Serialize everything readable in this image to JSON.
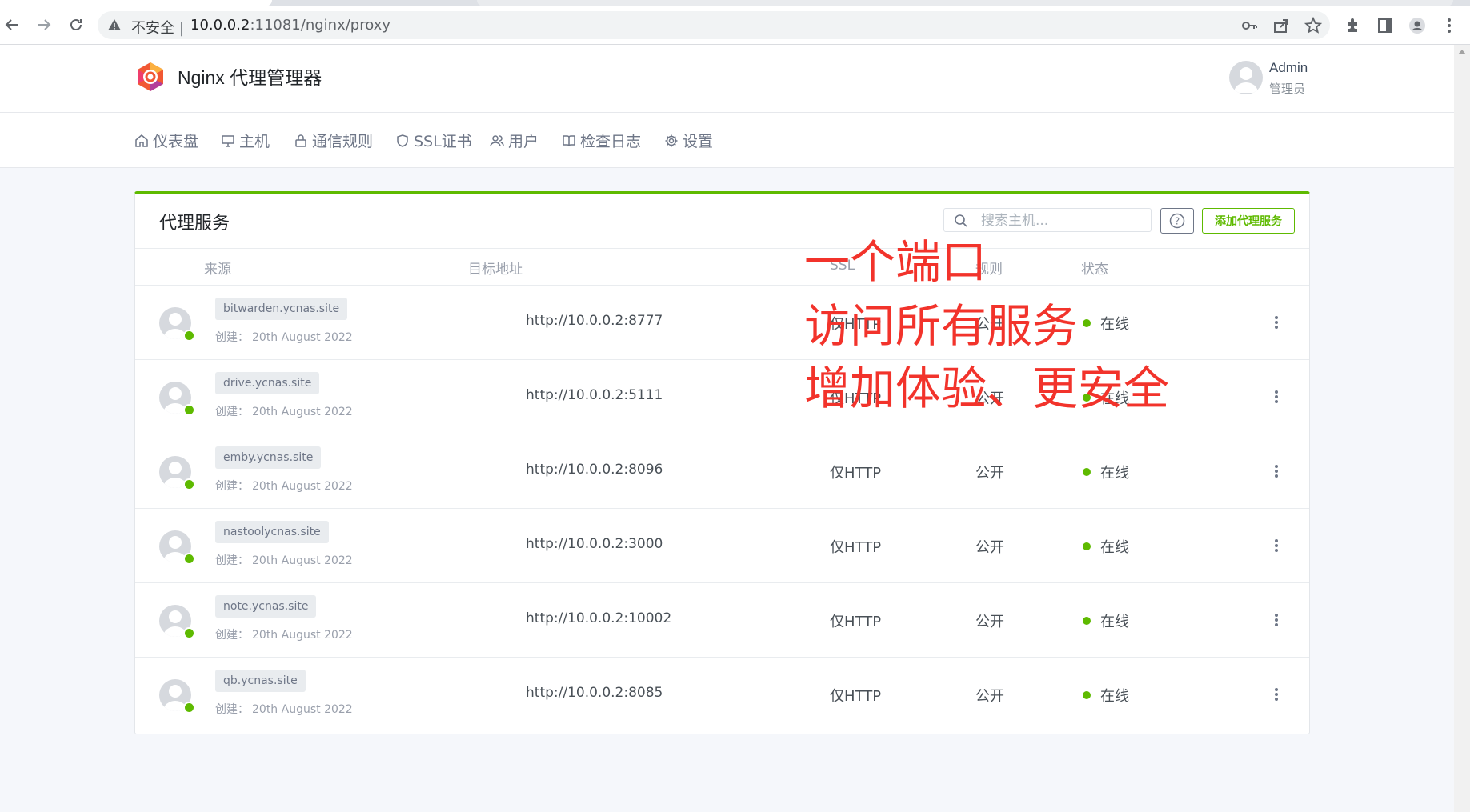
{
  "browser": {
    "security_label": "不安全",
    "separator": "|",
    "url_host": "10.0.0.2",
    "url_rest": ":11081/nginx/proxy"
  },
  "app": {
    "brand": "Nginx 代理管理器",
    "user_name": "Admin",
    "user_role": "管理员"
  },
  "nav": [
    {
      "label": "仪表盘",
      "icon": "home-icon"
    },
    {
      "label": "主机",
      "icon": "monitor-icon"
    },
    {
      "label": "通信规则",
      "icon": "lock-icon"
    },
    {
      "label": "SSL证书",
      "icon": "shield-icon"
    },
    {
      "label": "用户",
      "icon": "users-icon"
    },
    {
      "label": "检查日志",
      "icon": "book-icon"
    },
    {
      "label": "设置",
      "icon": "gear-icon"
    }
  ],
  "card": {
    "title": "代理服务",
    "search_placeholder": "搜索主机...",
    "add_label": "添加代理服务",
    "help_symbol": "?"
  },
  "columns": {
    "source": "来源",
    "dest": "目标地址",
    "ssl": "SSL",
    "rule": "规则",
    "status": "状态"
  },
  "rows": [
    {
      "domain": "bitwarden.ycnas.site",
      "created_label": "创建：",
      "created": "20th August 2022",
      "dest": "http://10.0.0.2:8777",
      "ssl": "仅HTTP",
      "rule": "公开",
      "status": "在线"
    },
    {
      "domain": "drive.ycnas.site",
      "created_label": "创建：",
      "created": "20th August 2022",
      "dest": "http://10.0.0.2:5111",
      "ssl": "仅HTTP",
      "rule": "公开",
      "status": "在线"
    },
    {
      "domain": "emby.ycnas.site",
      "created_label": "创建：",
      "created": "20th August 2022",
      "dest": "http://10.0.0.2:8096",
      "ssl": "仅HTTP",
      "rule": "公开",
      "status": "在线"
    },
    {
      "domain": "nastoolycnas.site",
      "created_label": "创建：",
      "created": "20th August 2022",
      "dest": "http://10.0.0.2:3000",
      "ssl": "仅HTTP",
      "rule": "公开",
      "status": "在线"
    },
    {
      "domain": "note.ycnas.site",
      "created_label": "创建：",
      "created": "20th August 2022",
      "dest": "http://10.0.0.2:10002",
      "ssl": "仅HTTP",
      "rule": "公开",
      "status": "在线"
    },
    {
      "domain": "qb.ycnas.site",
      "created_label": "创建：",
      "created": "20th August 2022",
      "dest": "http://10.0.0.2:8085",
      "ssl": "仅HTTP",
      "rule": "公开",
      "status": "在线"
    }
  ],
  "overlay": {
    "line1": "一个端口",
    "line2": "访问所有服务",
    "line3": "增加体验、更安全"
  },
  "colors": {
    "accent_green": "#5eba00",
    "overlay_red": "#f2332b"
  }
}
